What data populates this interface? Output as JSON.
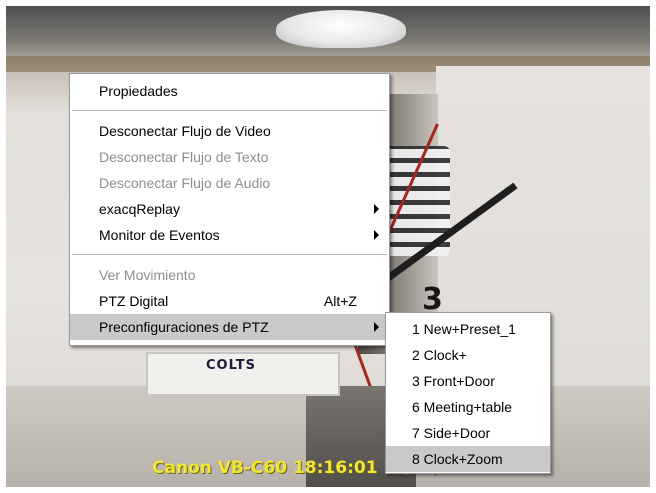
{
  "overlay_text": "Canon VB-C60 18:16:01 2?/0?/2011",
  "context_menu": {
    "items": [
      {
        "label": "Propiedades",
        "enabled": true
      },
      {
        "label": "Desconectar Flujo de Video",
        "enabled": true
      },
      {
        "label": "Desconectar Flujo de Texto",
        "enabled": false
      },
      {
        "label": "Desconectar Flujo de Audio",
        "enabled": false
      },
      {
        "label": "exacqReplay",
        "enabled": true,
        "submenu": true
      },
      {
        "label": "Monitor de Eventos",
        "enabled": true,
        "submenu": true
      },
      {
        "label": "Ver Movimiento",
        "enabled": false
      },
      {
        "label": "PTZ Digital",
        "enabled": true,
        "shortcut": "Alt+Z"
      },
      {
        "label": "Preconfiguraciones de PTZ",
        "enabled": true,
        "submenu": true,
        "highlighted": true
      }
    ]
  },
  "ptz_presets": {
    "items": [
      {
        "label": "1  New+Preset_1"
      },
      {
        "label": "2  Clock+"
      },
      {
        "label": "3  Front+Door"
      },
      {
        "label": "6  Meeting+table"
      },
      {
        "label": "7  Side+Door"
      },
      {
        "label": "8  Clock+Zoom",
        "highlighted": true
      }
    ]
  },
  "colors": {
    "menu_background": "#ffffff",
    "highlight": "#c9c9c9",
    "disabled_text": "#8e8e8e",
    "overlay_text": "#f2e533"
  },
  "scene_text": {
    "clock_number": "3",
    "plate": "COLTS"
  }
}
